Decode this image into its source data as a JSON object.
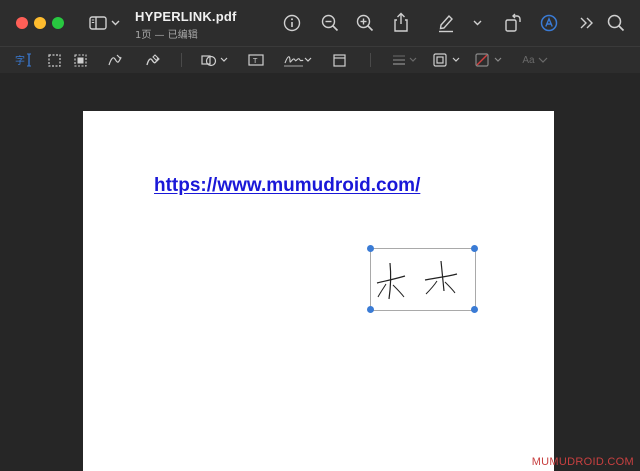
{
  "window": {
    "title": "HYPERLINK.pdf",
    "subtitle": "1页 — 已编辑"
  },
  "toolbar": {
    "icons": [
      "sidebar-toggle-icon",
      "chevron-down-icon",
      "info-icon",
      "zoom-out-icon",
      "zoom-in-icon",
      "share-icon",
      "highlight-pen-icon",
      "chevron-down-icon",
      "rotate-icon",
      "markup-icon",
      "more-icon",
      "search-icon"
    ]
  },
  "markup_toolbar": {
    "icons": [
      "text-selection-icon",
      "rectangle-selection-icon",
      "smart-lasso-icon",
      "sketch-icon",
      "draw-icon",
      "shapes-icon",
      "text-box-icon",
      "signature-icon",
      "note-icon",
      "shape-style-icon",
      "border-color-icon",
      "fill-color-icon",
      "text-style-icon"
    ],
    "text_style_label": "Aa"
  },
  "document": {
    "link_text": "https://www.mumudroid.com/",
    "accent_color": "#3a7bd5",
    "link_color": "#1a18d8"
  },
  "watermark": {
    "text": "MUMUDROID.COM"
  }
}
